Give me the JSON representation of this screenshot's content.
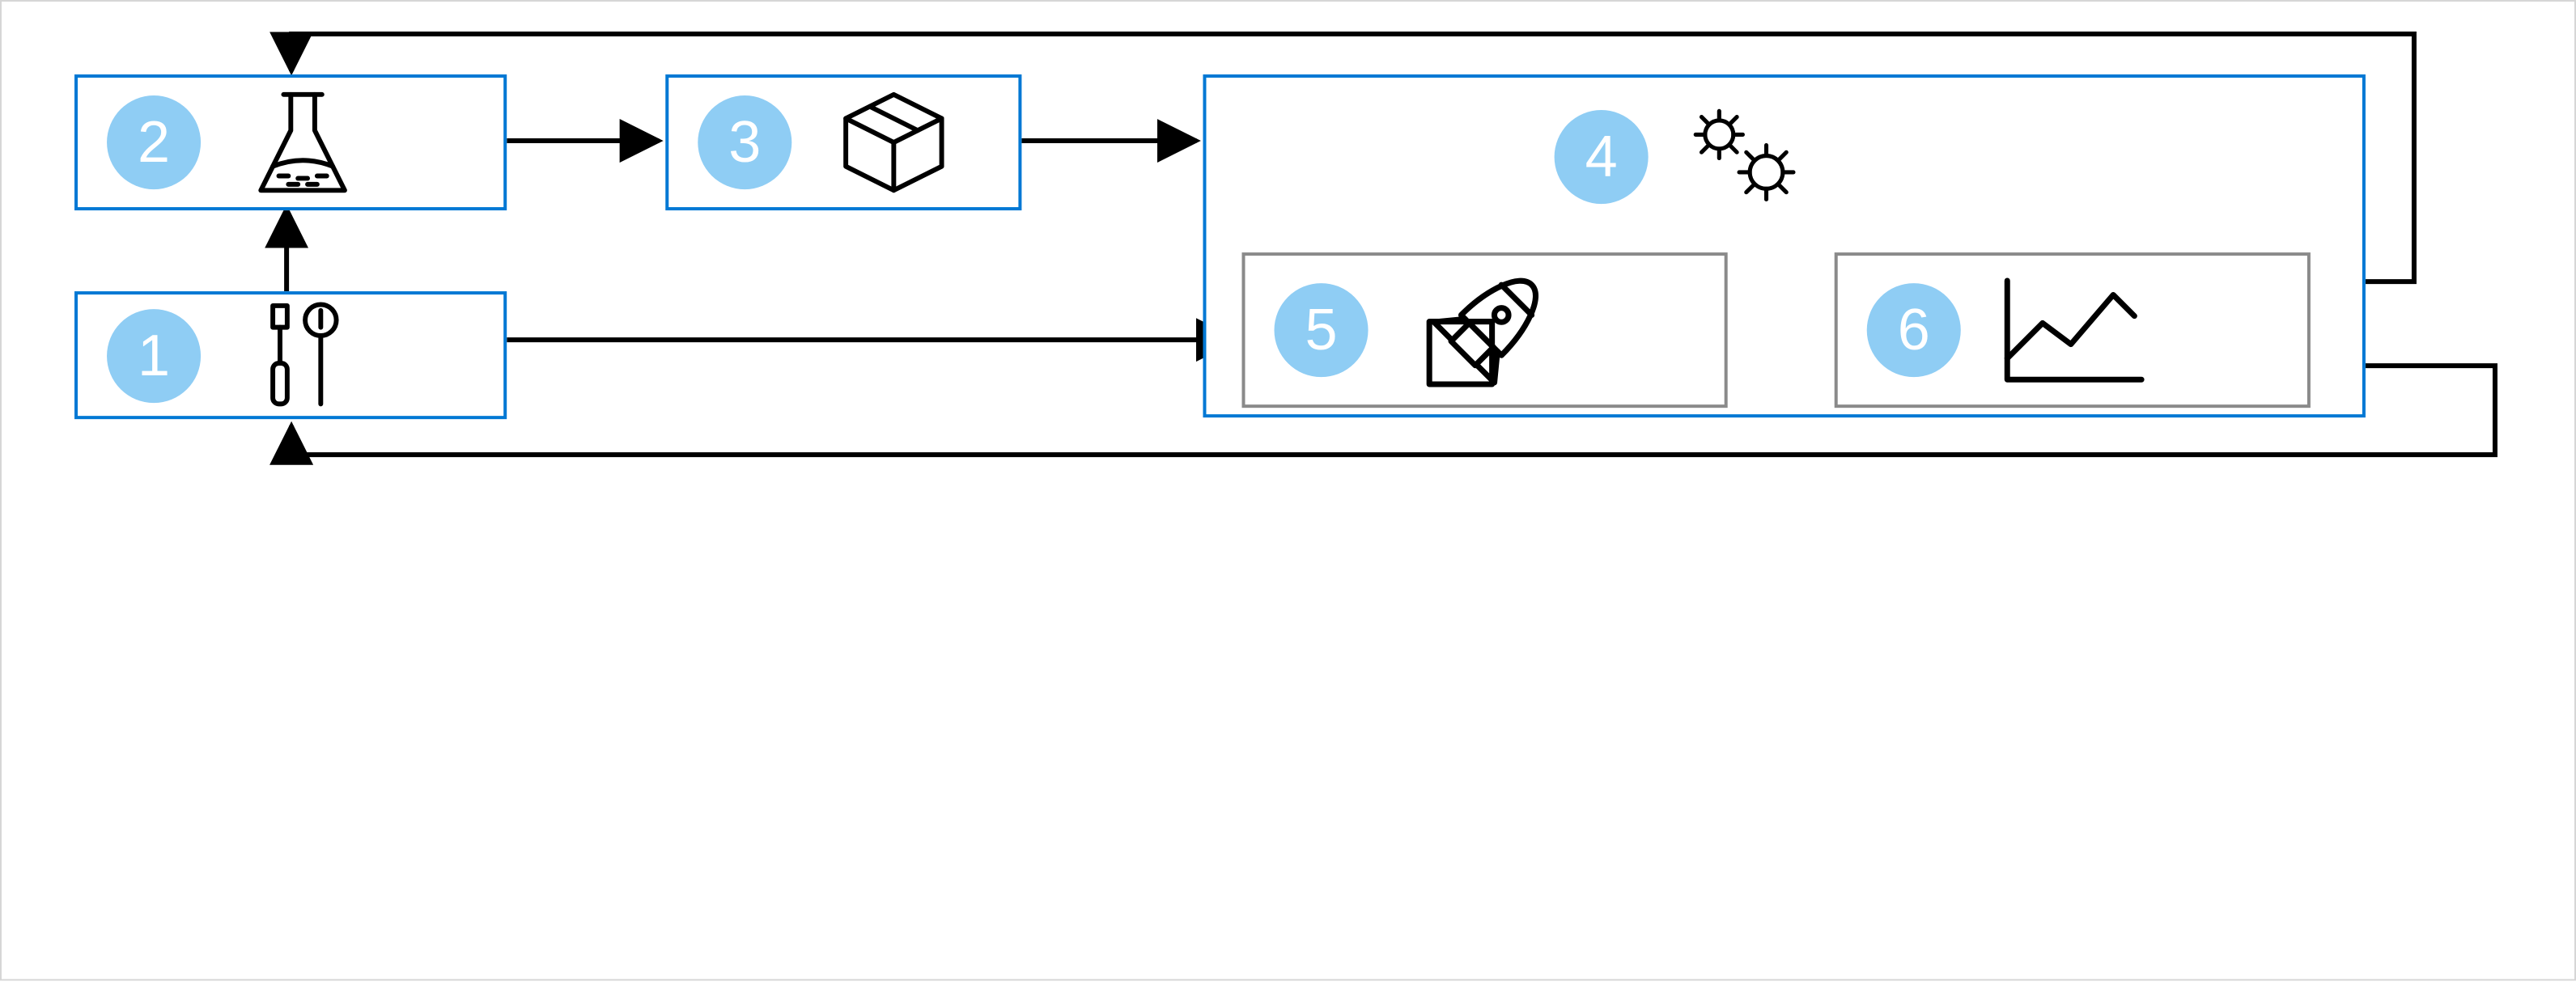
{
  "diagram": {
    "nodes": {
      "n1": {
        "num": "1",
        "icon": "tools-icon"
      },
      "n2": {
        "num": "2",
        "icon": "flask-icon"
      },
      "n3": {
        "num": "3",
        "icon": "package-icon"
      },
      "n4": {
        "num": "4",
        "icon": "gears-icon"
      },
      "n5": {
        "num": "5",
        "icon": "rocket-icon"
      },
      "n6": {
        "num": "6",
        "icon": "chart-icon"
      }
    },
    "colors": {
      "badge_bg": "#8fcdf4",
      "badge_fg": "#ffffff",
      "node_blue": "#0078d4",
      "node_gray": "#8a8a8a",
      "connector": "#000000"
    },
    "flows": [
      {
        "from": "n1",
        "to": "n2"
      },
      {
        "from": "n2",
        "to": "n3"
      },
      {
        "from": "n3",
        "to": "n4"
      },
      {
        "from": "n1",
        "to": "n5"
      },
      {
        "from": "n5",
        "to": "n6",
        "bidirectional": true
      },
      {
        "from": "n6",
        "to": "n2",
        "path": "top"
      },
      {
        "from": "n6",
        "to": "n1",
        "path": "bottom"
      }
    ]
  }
}
